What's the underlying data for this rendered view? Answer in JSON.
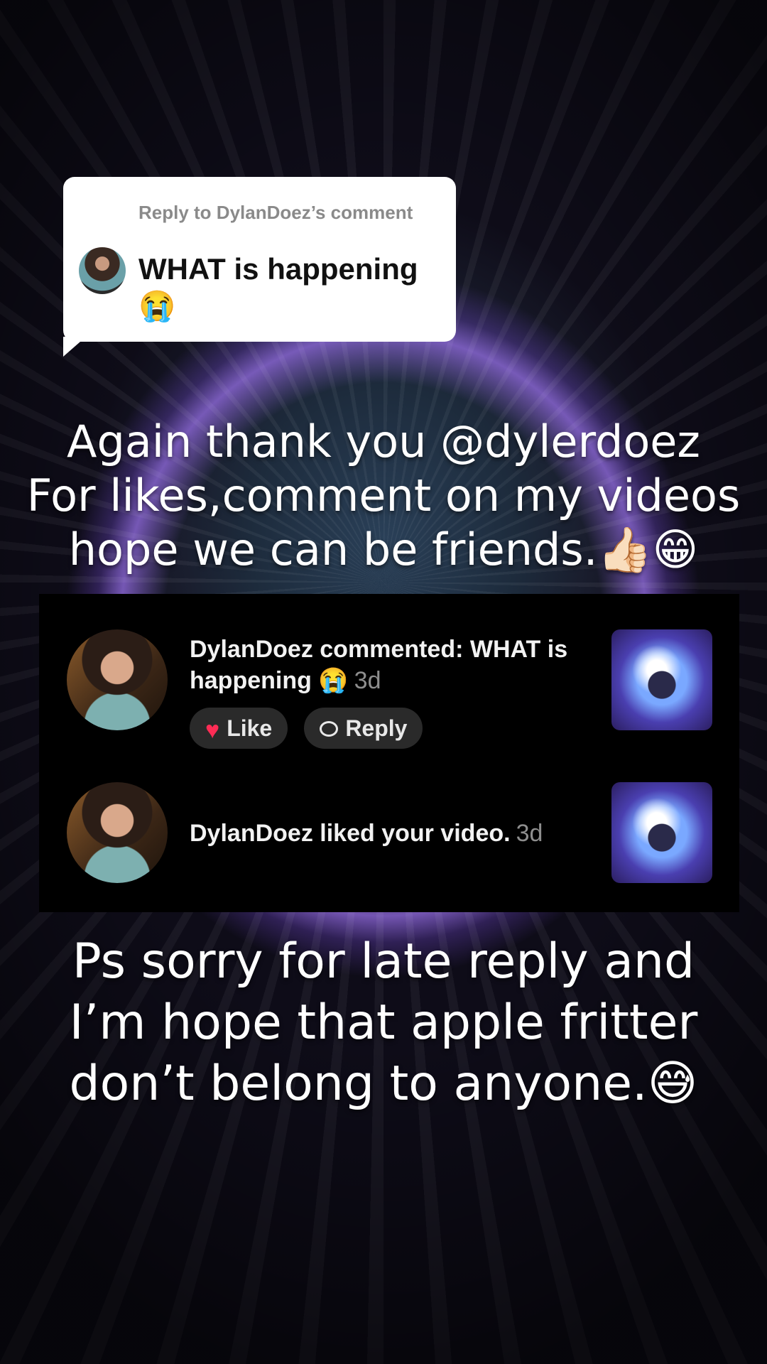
{
  "reply_card": {
    "header": "Reply to DylanDoez’s comment",
    "body": "WHAT is happening 😭"
  },
  "caption_top": {
    "line1": "Again thank you @dylerdoez",
    "line2": "For likes,comment on my videos",
    "line3": "hope we can be friends.👍🏻😁"
  },
  "notifications": [
    {
      "text": "DylanDoez commented: WHAT is happening 😭",
      "time": "3d",
      "like_label": "Like",
      "reply_label": "Reply"
    },
    {
      "text": "DylanDoez liked your video.",
      "time": "3d"
    }
  ],
  "caption_bottom": {
    "line1": "Ps sorry for late reply and",
    "line2": "I’m hope that apple fritter",
    "line3": "don’t belong to anyone.😅"
  },
  "colors": {
    "like_heart": "#fe2c55",
    "card_bg": "#ffffff",
    "panel_bg": "#000000"
  }
}
